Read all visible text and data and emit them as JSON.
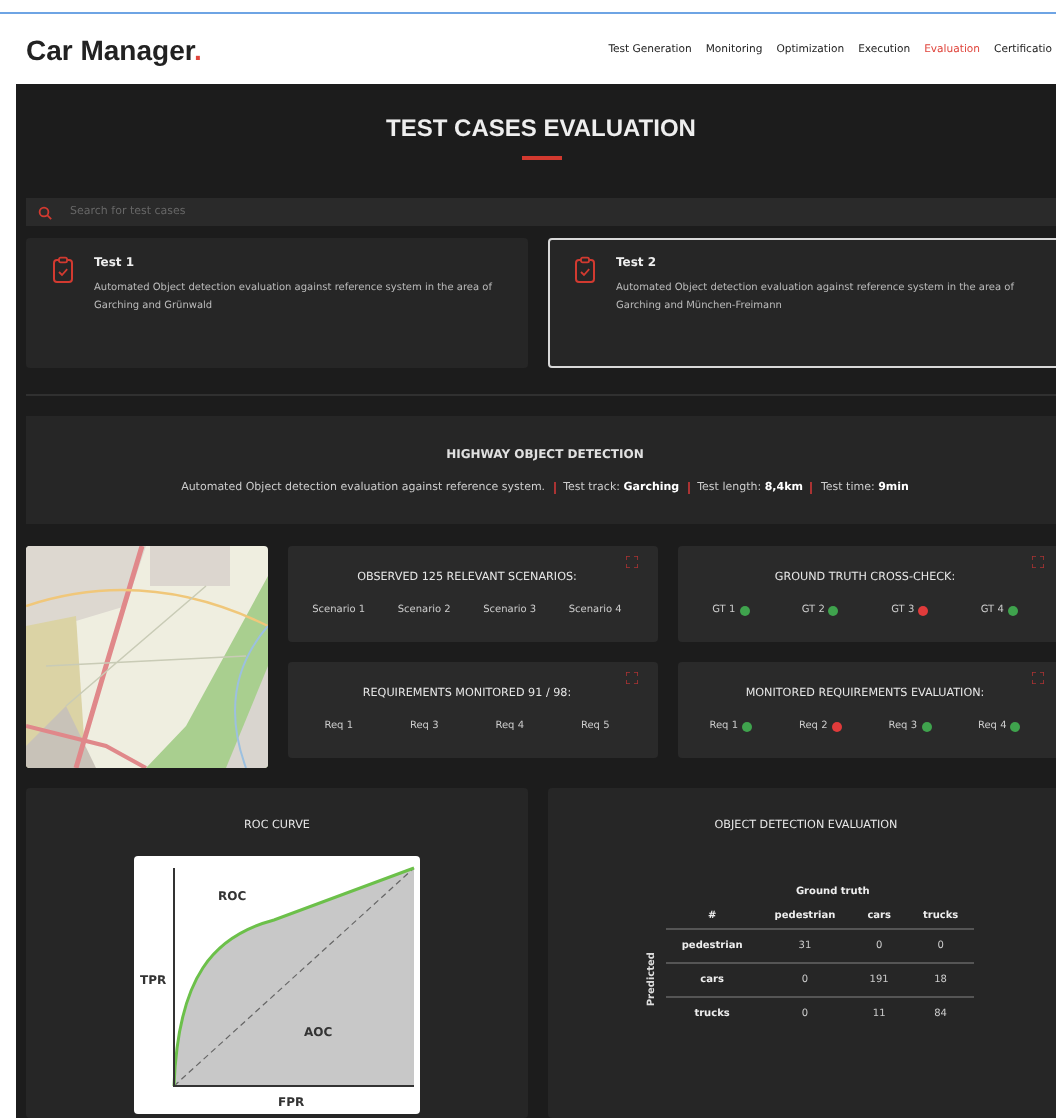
{
  "header": {
    "logo": "Car Manager",
    "logo_dot": ".",
    "nav": [
      {
        "label": "Test Generation",
        "selected": false
      },
      {
        "label": "Monitoring",
        "selected": false
      },
      {
        "label": "Optimization",
        "selected": false
      },
      {
        "label": "Execution",
        "selected": false
      },
      {
        "label": "Evaluation",
        "selected": true
      },
      {
        "label": "Certificatio",
        "selected": false
      }
    ]
  },
  "page_title": "TEST CASES EVALUATION",
  "search": {
    "placeholder": "Search for test cases"
  },
  "tests": [
    {
      "title": "Test 1",
      "description": "Automated Object detection evaluation against reference system in the area of Garching and Grünwald",
      "selected": false
    },
    {
      "title": "Test 2",
      "description": "Automated Object detection evaluation against reference system in the area of Garching and München-Freimann",
      "selected": true
    }
  ],
  "summary": {
    "title": "HIGHWAY OBJECT DETECTION",
    "facts": [
      "Automated Object detection evaluation against reference system.",
      "Test track: **Garching**",
      "Test length: **8,4km**",
      "Test time: **9min**"
    ]
  },
  "panels": [
    {
      "title": "OBSERVED 125 RELEVANT SCENARIOS:",
      "kind": "list",
      "items": [
        {
          "label": "Scenario 1"
        },
        {
          "label": "Scenario 2"
        },
        {
          "label": "Scenario 3"
        },
        {
          "label": "Scenario 4"
        }
      ]
    },
    {
      "title": "GROUND TRUTH CROSS-CHECK:",
      "kind": "status",
      "items": [
        {
          "label": "GT 1",
          "color": "#3fa34d"
        },
        {
          "label": "GT 2",
          "color": "#3fa34d"
        },
        {
          "label": "GT 3",
          "color": "#e03b3b"
        },
        {
          "label": "GT 4",
          "color": "#3fa34d"
        }
      ]
    },
    {
      "title": "REQUIREMENTS MONITORED 91 / 98:",
      "kind": "list",
      "items": [
        {
          "label": "Req 1"
        },
        {
          "label": "Req 3"
        },
        {
          "label": "Req 4"
        },
        {
          "label": "Req 5"
        }
      ]
    },
    {
      "title": "MONITORED REQUIREMENTS EVALUATION:",
      "kind": "status",
      "items": [
        {
          "label": "Req 1",
          "color": "#3fa34d"
        },
        {
          "label": "Req 2",
          "color": "#e03b3b"
        },
        {
          "label": "Req 3",
          "color": "#3fa34d"
        },
        {
          "label": "Req 4",
          "color": "#3fa34d"
        }
      ]
    }
  ],
  "roc": {
    "title": "ROC CURVE",
    "curve_label": "ROC",
    "y_label": "TPR",
    "area_label": "AOC",
    "x_label": "FPR"
  },
  "evaluation": {
    "title": "OBJECT DETECTION EVALUATION",
    "column_group": "Ground truth",
    "row_group": "Predicted",
    "columns": [
      "#",
      "pedestrian",
      "cars",
      "trucks"
    ],
    "rows": [
      {
        "label": "pedestrian",
        "values": [
          "31",
          "0",
          "0"
        ]
      },
      {
        "label": "cars",
        "values": [
          "0",
          "191",
          "18"
        ]
      },
      {
        "label": "trucks",
        "values": [
          "0",
          "11",
          "84"
        ]
      }
    ]
  }
}
